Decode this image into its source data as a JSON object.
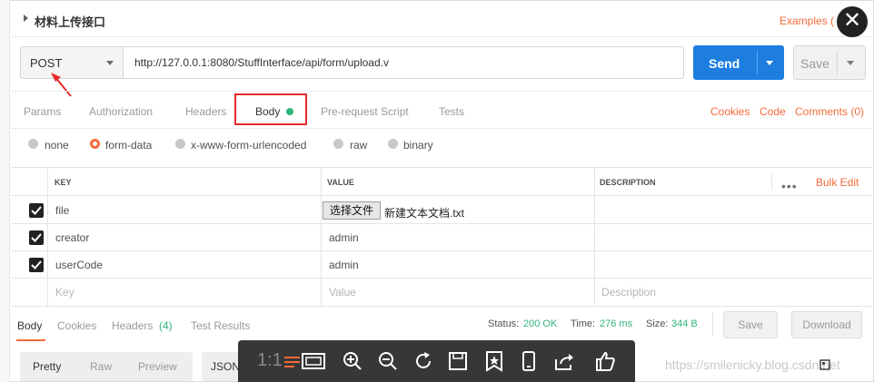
{
  "header": {
    "title": "材料上传接口",
    "examples": "Examples (",
    "close_glyph": "✕"
  },
  "request": {
    "method": "POST",
    "url": "http://127.0.0.1:8080/StuffInterface/api/form/upload.v",
    "send": "Send",
    "save": "Save"
  },
  "req_tabs": {
    "params": "Params",
    "authorization": "Authorization",
    "headers": "Headers",
    "body": "Body",
    "prerequest": "Pre-request Script",
    "tests": "Tests",
    "cookies": "Cookies",
    "code": "Code",
    "comments": "Comments (0)"
  },
  "body_types": {
    "none": "none",
    "form_data": "form-data",
    "urlencoded": "x-www-form-urlencoded",
    "raw": "raw",
    "binary": "binary",
    "selected": "form-data"
  },
  "table": {
    "col_key": "KEY",
    "col_value": "VALUE",
    "col_description": "DESCRIPTION",
    "more": "•••",
    "bulk_edit": "Bulk Edit",
    "rows": [
      {
        "checked": true,
        "key": "file",
        "file_button": "选择文件",
        "value": "新建文本文档.txt",
        "description": ""
      },
      {
        "checked": true,
        "key": "creator",
        "value": "admin",
        "description": ""
      },
      {
        "checked": true,
        "key": "userCode",
        "value": "admin",
        "description": ""
      }
    ],
    "placeholder": {
      "key": "Key",
      "value": "Value",
      "description": "Description"
    }
  },
  "response": {
    "tabs": {
      "body": "Body",
      "cookies": "Cookies",
      "headers": "Headers",
      "headers_count": "(4)",
      "test_results": "Test Results"
    },
    "status_label": "Status:",
    "status_value": "200 OK",
    "time_label": "Time:",
    "time_value": "276 ms",
    "size_label": "Size:",
    "size_value": "344 B",
    "save": "Save",
    "download": "Download"
  },
  "view_tabs": {
    "pretty": "Pretty",
    "raw": "Raw",
    "preview": "Preview",
    "format": "JSON"
  },
  "viewer": {
    "ratio": "1:1"
  },
  "watermark": "https://smilenicky.blog.csdn.net",
  "colors": {
    "accent": "#f26b3a",
    "send": "#1d7ee0",
    "status_ok": "#2fb57c",
    "highlight": "#e52b2b"
  }
}
